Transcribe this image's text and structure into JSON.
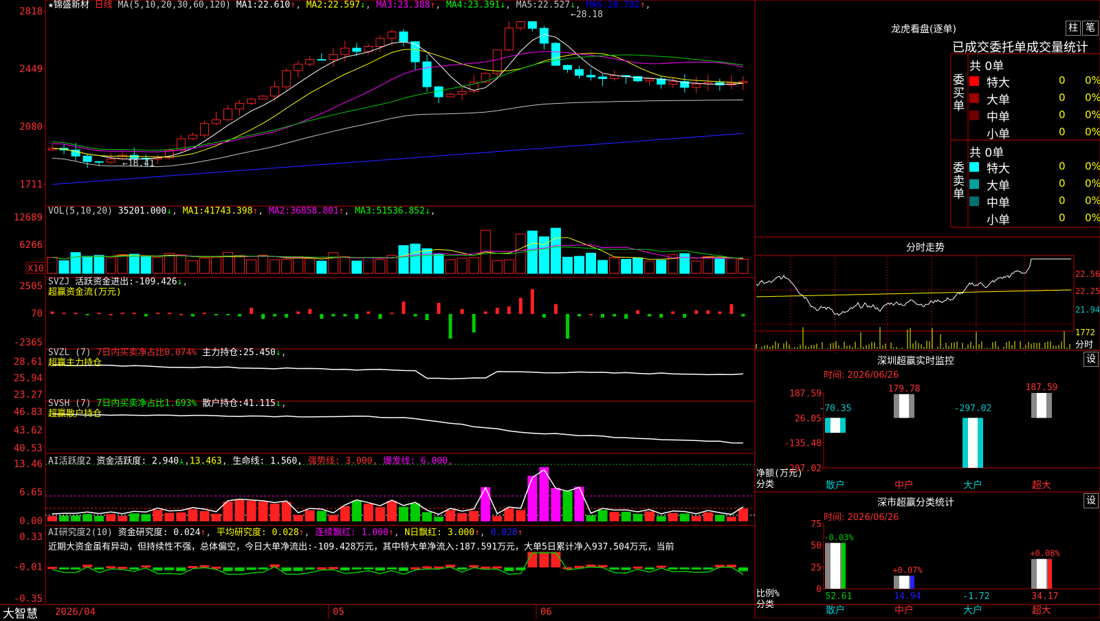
{
  "header": {
    "star": "★",
    "stock_name": "锦盛新材",
    "period": "日线",
    "ma_params": "MA(5,10,20,30,60,120)",
    "ma": [
      {
        "label": "MA1:",
        "value": "22.610",
        "arrow": "↑",
        "color": "#ffffff"
      },
      {
        "label": "MA2:",
        "value": "22.597",
        "arrow": "↓",
        "color": "#ffff00"
      },
      {
        "label": "MA3:",
        "value": "23.388",
        "arrow": "↑",
        "color": "#ff00ff"
      },
      {
        "label": "MA4:",
        "value": "23.391",
        "arrow": "↓",
        "color": "#00ff00"
      },
      {
        "label": "MA5:",
        "value": "22.527",
        "arrow": "↓",
        "color": "#c8c8c8"
      },
      {
        "label": "MA6:",
        "value": "20.782",
        "arrow": "↑",
        "color": "#0000ff"
      }
    ],
    "high_note": "←28.18",
    "low_note": "←18.41"
  },
  "price_axis": [
    "2818",
    "2449",
    "2080",
    "1711"
  ],
  "vol": {
    "header": "VOL(5,10,20)",
    "value": "35201.000",
    "arrow": "↓",
    "ma": [
      {
        "label": "MA1:",
        "value": "41743.398",
        "arrow": "↑",
        "color": "#ffff00"
      },
      {
        "label": "MA2:",
        "value": "36858.801",
        "arrow": "↑",
        "color": "#ff00ff"
      },
      {
        "label": "MA3:",
        "value": "51536.852",
        "arrow": "↓",
        "color": "#00ff00"
      }
    ],
    "axis": [
      "12689",
      "6266"
    ],
    "unit": "X10"
  },
  "svzj": {
    "name": "SVZJ",
    "label": "活跃资金进出:",
    "value": "-109.426",
    "arrow": "↓",
    "sub": "超赢资金流(万元)",
    "axis": [
      "2505",
      "70",
      "-2365"
    ]
  },
  "svzl": {
    "name": "SVZL (7)",
    "label_red": "7日内买卖净占比0.074%",
    "label2": "主力持仓:",
    "value": "25.450",
    "arrow": "↓",
    "sub": "超赢主力持仓",
    "axis": [
      "28.61",
      "25.94",
      "23.27"
    ]
  },
  "svsh": {
    "name": "SVSH (7)",
    "label_green": "7日内买卖净占比1.693%",
    "label2": "散户持仓:",
    "value": "41.115",
    "arrow": "↓",
    "sub": "超赢散户持仓",
    "axis": [
      "46.83",
      "43.62",
      "40.53"
    ]
  },
  "ai_active": {
    "name": "AI活跃度2",
    "label": "资金活跃度:",
    "value": "2.940",
    "arrow": "↓",
    "v2": "13.463",
    "life": "生命线: 1.560,",
    "strong": "强势线: 3.000,",
    "burst": "爆发线: 6.000,",
    "axis": [
      "13.46",
      "6.65",
      "0.00"
    ]
  },
  "ai_research": {
    "name": "AI研究度2(10)",
    "label": "资金研究度:",
    "value": "0.024",
    "arrow": "↑",
    "avg": "平均研究度: 0.028",
    "red": "连续飘红: 1.000",
    "nred": "N日飘红: 3.000",
    "last": "0.028",
    "axis": [
      "0.33",
      "-0.01",
      "-0.35"
    ],
    "comment": "近期大资金虽有异动，但持续性不强，总体偏空，今日大单净流出:-109.428万元，其中特大单净流入:187.591万元，大单5日累计净入937.504万元，当前"
  },
  "date_axis": [
    "2026/04",
    "05",
    "06"
  ],
  "brand": "大智慧",
  "dragon": {
    "title": "龙虎看盘(逐单)",
    "tab1": "柱",
    "tab2": "笔",
    "subtitle": "已成交委托单成交量统计",
    "buy": {
      "side_label": "委买单",
      "total": "共 0单",
      "rows": [
        {
          "label": "特大",
          "vol": "0",
          "pct": "0%",
          "color": "#ff0000"
        },
        {
          "label": "大单",
          "vol": "0",
          "pct": "0%",
          "color": "#a00000"
        },
        {
          "label": "中单",
          "vol": "0",
          "pct": "0%",
          "color": "#700000"
        },
        {
          "label": "小单",
          "vol": "0",
          "pct": "0%",
          "color": "#000000"
        }
      ]
    },
    "sell": {
      "side_label": "委卖单",
      "total": "共 0单",
      "rows": [
        {
          "label": "特大",
          "vol": "0",
          "pct": "0%",
          "color": "#00ffff"
        },
        {
          "label": "大单",
          "vol": "0",
          "pct": "0%",
          "color": "#00a0a0"
        },
        {
          "label": "中单",
          "vol": "0",
          "pct": "0%",
          "color": "#007070"
        },
        {
          "label": "小单",
          "vol": "0",
          "pct": "0%",
          "color": "#000000"
        }
      ]
    }
  },
  "minute": {
    "title": "分时走势",
    "axis": [
      "22.56",
      "22.25",
      "21.94"
    ],
    "vol_axis": "1772",
    "vol_label": "分时"
  },
  "monitor": {
    "title": "深圳超赢实时监控",
    "time": "时间: 2026/06/26",
    "btn": "设",
    "axis": [
      "187.59",
      "26.05",
      "-135.48",
      "-297.02"
    ],
    "ylabel": "净额(万元)",
    "xlabel": "分类",
    "bars": [
      {
        "cat": "散户",
        "value": -70.35,
        "text": "-70.35"
      },
      {
        "cat": "中户",
        "value": 179.78,
        "text": "179.78"
      },
      {
        "cat": "大户",
        "value": -297.02,
        "text": "-297.02"
      },
      {
        "cat": "超大",
        "value": 187.59,
        "text": "187.59"
      }
    ]
  },
  "classify": {
    "title": "深市超赢分类统计",
    "time": "时间: 2026/06/26",
    "btn": "设",
    "axis": [
      "75",
      "50",
      "25",
      "0"
    ],
    "ylabel": "比例%",
    "xlabel": "分类",
    "bars": [
      {
        "cat": "散户",
        "value": 52.61,
        "text": "52.61",
        "change": "-0.03%",
        "color": "#00cc00"
      },
      {
        "cat": "中户",
        "value": 14.94,
        "text": "14.94",
        "change": "+0.07%",
        "color": "#2020ff"
      },
      {
        "cat": "大户",
        "value": -1.72,
        "text": "-1.72",
        "change": "",
        "color": "#00cccc"
      },
      {
        "cat": "超大",
        "value": 34.17,
        "text": "34.17",
        "change": "+0.08%",
        "color": "#ff2020"
      }
    ]
  }
}
